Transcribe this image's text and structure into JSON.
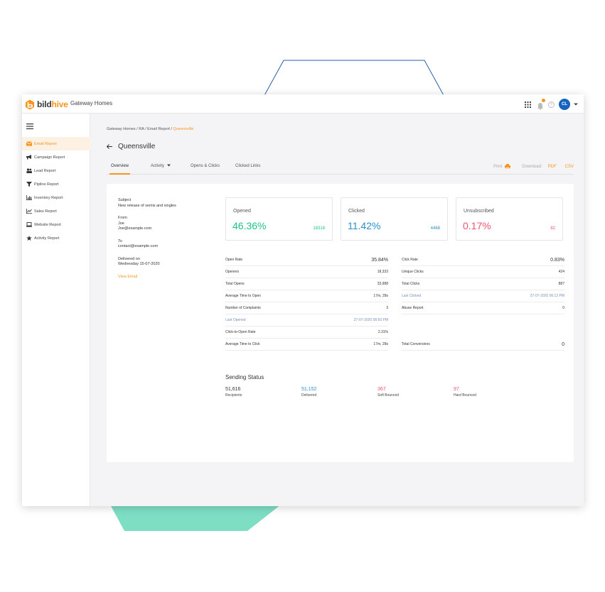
{
  "colors": {
    "brand_orange": "#f7941d",
    "opened_green": "#1ec08c",
    "clicked_blue": "#2b8fc9",
    "unsub_pink": "#f2536f",
    "avatar_blue": "#1565c0",
    "decor_teal": "#7ddec4",
    "decor_line": "#2a5fa8"
  },
  "header": {
    "logo_part1": "bild",
    "logo_part2": "hive",
    "org_name": "Gateway Homes",
    "avatar_initials": "CL",
    "icons": [
      "apps-grid-icon",
      "bell-icon",
      "help-icon",
      "chevron-down-icon"
    ]
  },
  "sidebar": {
    "items": [
      {
        "label": "Email Report",
        "icon": "envelope-icon"
      },
      {
        "label": "Campaign Report",
        "icon": "megaphone-icon"
      },
      {
        "label": "Lead Report",
        "icon": "users-icon"
      },
      {
        "label": "Pipline Report",
        "icon": "funnel-icon"
      },
      {
        "label": "Inventory Report",
        "icon": "bar-chart-icon"
      },
      {
        "label": "Sales Report",
        "icon": "line-chart-icon"
      },
      {
        "label": "Website Report",
        "icon": "laptop-icon"
      },
      {
        "label": "Activity Report",
        "icon": "star-icon"
      }
    ]
  },
  "breadcrumb": {
    "path": "Gateway Homes / RA / Email Report / ",
    "current": "Queensville"
  },
  "page": {
    "title": "Queensville"
  },
  "tabs": {
    "overview": "Overview",
    "activity": "Activity",
    "opens_clicks": "Opens & Clicks",
    "clicked_links": "Clicked Links"
  },
  "tools": {
    "print": "Print",
    "download": "Download:",
    "pdf": "PDF",
    "csv": "CSV"
  },
  "email_info": {
    "subject_label": "Subject",
    "subject_value": "New release of semis and singles",
    "from_label": "From",
    "from_name": "Joe",
    "from_email": "Joe@example.com",
    "to_label": "To",
    "to_email": "contact@example.com",
    "delivered_label": "Delivered on",
    "delivered_value": "Wednesday 15-07-2020",
    "view_email": "View Email"
  },
  "stats": {
    "opened": {
      "label": "Opened",
      "percent": "46.36%",
      "count": "18318"
    },
    "clicked": {
      "label": "Clicked",
      "percent": "11.42%",
      "count": "4468"
    },
    "unsubscribed": {
      "label": "Unsubscribed",
      "percent": "0.17%",
      "count": "82"
    }
  },
  "metrics_left": [
    {
      "label": "Open Rate",
      "value": "35.84%"
    },
    {
      "label": "Openers",
      "value": "18,333"
    },
    {
      "label": "Total Opens",
      "value": "33,988"
    },
    {
      "label": "Average Time to Open",
      "value": "17m, 28s"
    },
    {
      "label": "Number of Complaints",
      "value": "3"
    },
    {
      "label": "Last Opened",
      "value": "27-07-2020 06:50 PM"
    },
    {
      "label": "Click-to-Open Rate",
      "value": "2.31%"
    },
    {
      "label": "Average Time to Click",
      "value": "17m, 28s"
    }
  ],
  "metrics_right": [
    {
      "label": "Click Rate",
      "value": "0.83%"
    },
    {
      "label": "Unique Clicks",
      "value": "424"
    },
    {
      "label": "Total Clicks",
      "value": "887"
    },
    {
      "label": "Last Clicked",
      "value": "27-07-2020 06:12 PM"
    },
    {
      "label": "Abuse Report",
      "value": "0"
    }
  ],
  "total_conversions": {
    "label": "Total Conversions",
    "value": "0"
  },
  "sending_status": {
    "title": "Sending Status",
    "items": [
      {
        "value": "51,616",
        "label": "Recipients"
      },
      {
        "value": "51,152",
        "label": "Delivered"
      },
      {
        "value": "367",
        "label": "Soft Bounced"
      },
      {
        "value": "97",
        "label": "Hard Bounced"
      }
    ]
  }
}
